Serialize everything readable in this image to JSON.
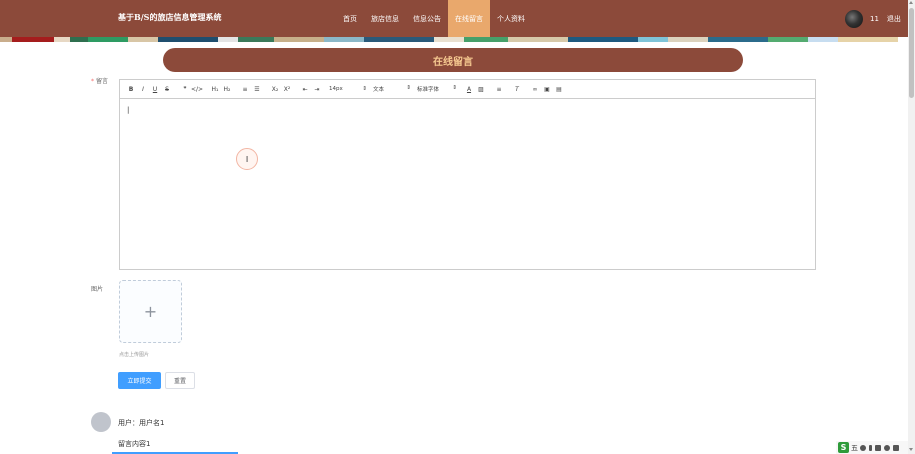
{
  "header": {
    "site_title": "基于B/S的旅店信息管理系统",
    "nav": [
      {
        "label": "首页",
        "active": false
      },
      {
        "label": "旅店信息",
        "active": false
      },
      {
        "label": "信息公告",
        "active": false
      },
      {
        "label": "在线留言",
        "active": true
      },
      {
        "label": "个人资料",
        "active": false
      }
    ],
    "user_name": "11",
    "logout_label": "退出"
  },
  "colors": {
    "header_bg": "#8c4a3a",
    "nav_active_bg": "#e9a86c",
    "banner_text": "#f5c890",
    "primary_button": "#409eff",
    "required_mark": "#f56c6c"
  },
  "page_title": "在线留言",
  "form": {
    "message_label": "留言",
    "required_mark": "*",
    "editor": {
      "toolbar": {
        "format_buttons": [
          "B",
          "I",
          "U",
          "S",
          "❞",
          "</>",
          "H₁",
          "H₂",
          "≡",
          "☰",
          "X₂",
          "X²",
          "⇤",
          "⇥"
        ],
        "size_select": "14px",
        "paragraph_select": "文本",
        "font_select": "标准字体",
        "icons": [
          "font-color-icon",
          "background-color-icon",
          "align-icon",
          "clear-format-icon",
          "link-icon",
          "image-icon",
          "video-icon"
        ]
      },
      "content": "|"
    },
    "image_label": "图片",
    "upload_plus": "+",
    "upload_hint": "点击上传图片",
    "submit_label": "立即提交",
    "reset_label": "重置"
  },
  "cursor_glyph": "I",
  "comments": [
    {
      "user": "用户：用户名1",
      "content": "留言内容1"
    }
  ],
  "tray": {
    "logo": "S",
    "ime_char": "五"
  }
}
